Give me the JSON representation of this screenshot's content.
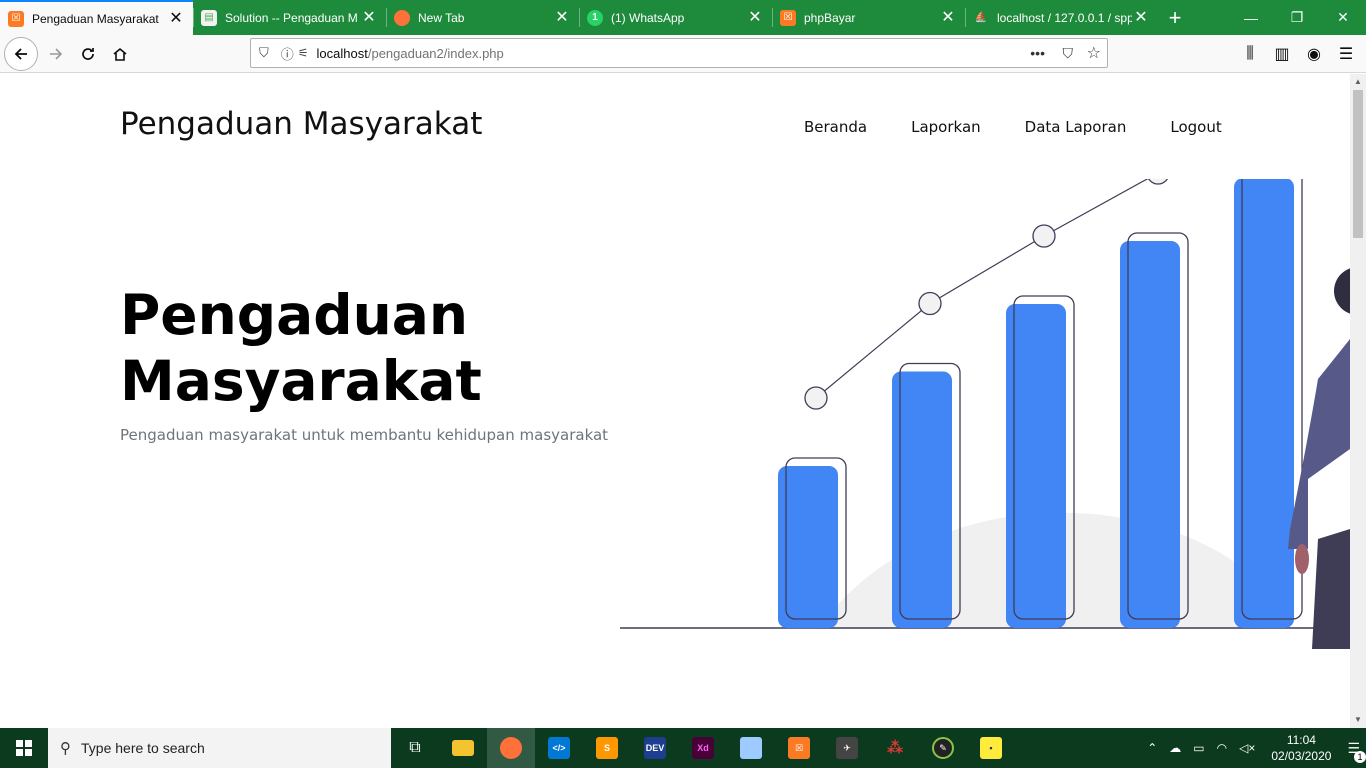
{
  "tabs": [
    {
      "title": "Pengaduan Masyarakat",
      "icon": "xampp-icon",
      "color": "#fb7a24",
      "active": true
    },
    {
      "title": "Solution -- Pengaduan M",
      "icon": "document-icon",
      "color": "#4caf50",
      "active": false
    },
    {
      "title": "New Tab",
      "icon": "firefox-icon",
      "color": "#ff7139",
      "active": false
    },
    {
      "title": "(1) WhatsApp",
      "icon": "whatsapp-icon",
      "color": "#25d366",
      "active": false
    },
    {
      "title": "phpBayar",
      "icon": "xampp-icon",
      "color": "#fb7a24",
      "active": false
    },
    {
      "title": "localhost / 127.0.0.1 / spp",
      "icon": "phpmyadmin-icon",
      "color": "#f5a623",
      "active": false
    }
  ],
  "url": {
    "host": "localhost",
    "path": "/pengaduan2/index.php"
  },
  "site": {
    "brand": "Pengaduan Masyarakat",
    "menu": [
      "Beranda",
      "Laporkan",
      "Data Laporan",
      "Logout"
    ],
    "hero_title": "Pengaduan Masyarakat",
    "hero_sub": "Pengaduan masyarakat untuk membantu kehidupan masyarakat"
  },
  "illustration": {
    "bar_levels": [
      0.36,
      0.57,
      0.72,
      0.86,
      1.0
    ],
    "bar_color": "#4285f4"
  },
  "taskbar": {
    "search_placeholder": "Type here to search",
    "apps": [
      "task-view-icon",
      "file-explorer-icon",
      "firefox-icon",
      "vscode-icon",
      "sublime-icon",
      "devc-icon",
      "xd-icon",
      "box-icon",
      "xampp-icon",
      "game-icon",
      "network-icon",
      "inkscape-icon",
      "sticky-notes-icon"
    ],
    "time": "11:04",
    "date": "02/03/2020",
    "notifications": "1"
  }
}
